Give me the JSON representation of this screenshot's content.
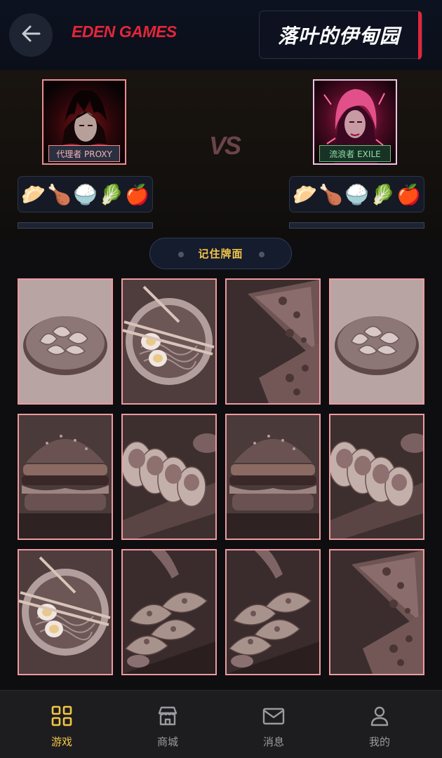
{
  "header": {
    "brand": "EDEN GAMES",
    "title": "落叶的伊甸园"
  },
  "players": {
    "left": {
      "tag": "代理者 PROXY",
      "foods": [
        "🥟",
        "🍗",
        "🍚",
        "🥬",
        "🍎"
      ],
      "progress": 0
    },
    "right": {
      "tag": "流浪者 EXILE",
      "foods": [
        "🥟",
        "🍗",
        "🍚",
        "🥬",
        "🍎"
      ],
      "progress": 0
    },
    "vs": "VS"
  },
  "status": {
    "label": "记住牌面"
  },
  "cards": [
    {
      "food": "dumplings"
    },
    {
      "food": "ramen"
    },
    {
      "food": "pizza"
    },
    {
      "food": "dumplings"
    },
    {
      "food": "burger"
    },
    {
      "food": "sushi"
    },
    {
      "food": "burger"
    },
    {
      "food": "sushi"
    },
    {
      "food": "ramen"
    },
    {
      "food": "tacos"
    },
    {
      "food": "tacos"
    },
    {
      "food": "pizza"
    }
  ],
  "nav": [
    {
      "label": "游戏",
      "icon": "grid-icon",
      "active": true
    },
    {
      "label": "商城",
      "icon": "store-icon",
      "active": false
    },
    {
      "label": "消息",
      "icon": "mail-icon",
      "active": false
    },
    {
      "label": "我的",
      "icon": "user-icon",
      "active": false
    }
  ],
  "colors": {
    "accent": "#e3263a",
    "gold": "#f3c548",
    "card_border": "#ee9aa0"
  }
}
